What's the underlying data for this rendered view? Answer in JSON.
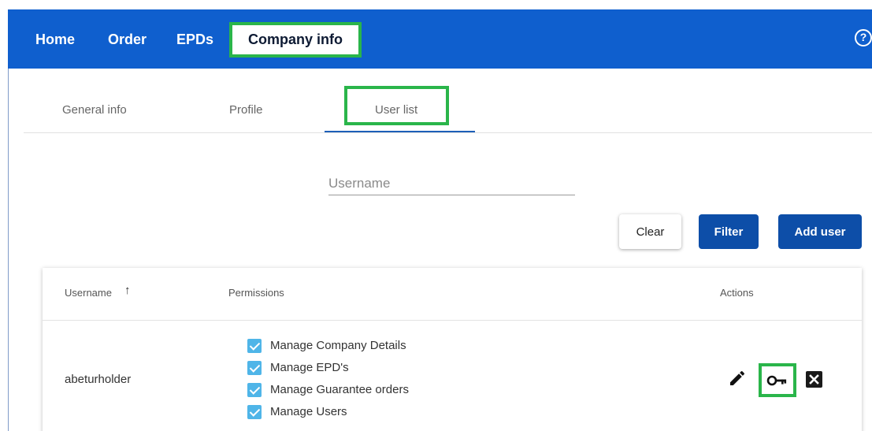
{
  "nav": {
    "home": "Home",
    "order": "Order",
    "epds": "EPDs",
    "company_info": "Company info",
    "help_glyph": "?"
  },
  "tabs": [
    {
      "label": "General info"
    },
    {
      "label": "Profile"
    },
    {
      "label": "User list",
      "active": true
    }
  ],
  "filter": {
    "username_placeholder": "Username",
    "username_value": ""
  },
  "buttons": {
    "clear": "Clear",
    "filter": "Filter",
    "add_user": "Add user"
  },
  "table": {
    "columns": {
      "username": "Username",
      "permissions": "Permissions",
      "actions": "Actions"
    },
    "sort_glyph": "↑",
    "rows": [
      {
        "username": "abeturholder",
        "permissions": [
          "Manage Company Details",
          "Manage EPD's",
          "Manage Guarantee orders",
          "Manage Users"
        ]
      }
    ]
  },
  "icons": {
    "edit": "pencil-icon",
    "key": "key-icon",
    "delete": "close-box-icon",
    "help": "help-circle-icon",
    "sort": "arrow-up-icon"
  },
  "colors": {
    "topbar": "#0f5fce",
    "highlight": "#2ab54a",
    "primary_button": "#0d4ea8",
    "checkbox": "#4fb5e8"
  }
}
